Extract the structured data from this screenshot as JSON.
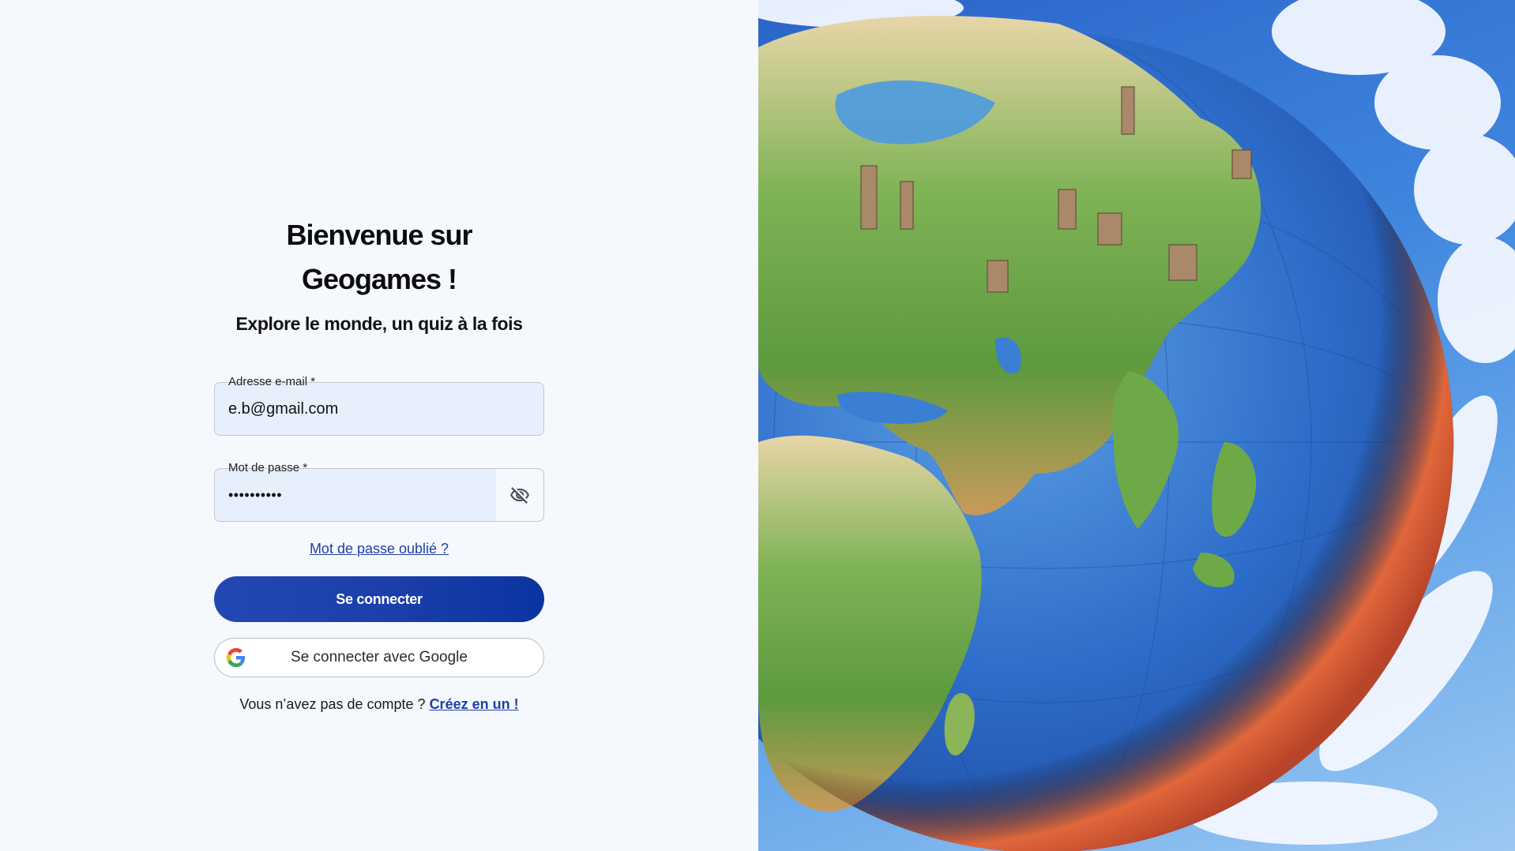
{
  "login": {
    "title": "Bienvenue sur Geogames !",
    "subtitle": "Explore le monde, un quiz à la fois",
    "email": {
      "label": "Adresse e-mail *",
      "value": "e.b@gmail.com"
    },
    "password": {
      "label": "Mot de passe *",
      "value": "••••••••••",
      "toggle_icon": "eye-off-icon"
    },
    "forgot_link": "Mot de passe oublié ?",
    "submit_label": "Se connecter",
    "google": {
      "label": "Se connecter avec Google",
      "icon": "google-icon"
    },
    "signup": {
      "prompt": "Vous n’avez pas de compte ?",
      "link": "Créez en un !"
    }
  },
  "hero": {
    "image": "illustrated-earth-globe"
  },
  "colors": {
    "background": "#f5f8fd",
    "primary": "#1a3eaa",
    "link": "#1f3fa6",
    "field": "#e8effc"
  }
}
